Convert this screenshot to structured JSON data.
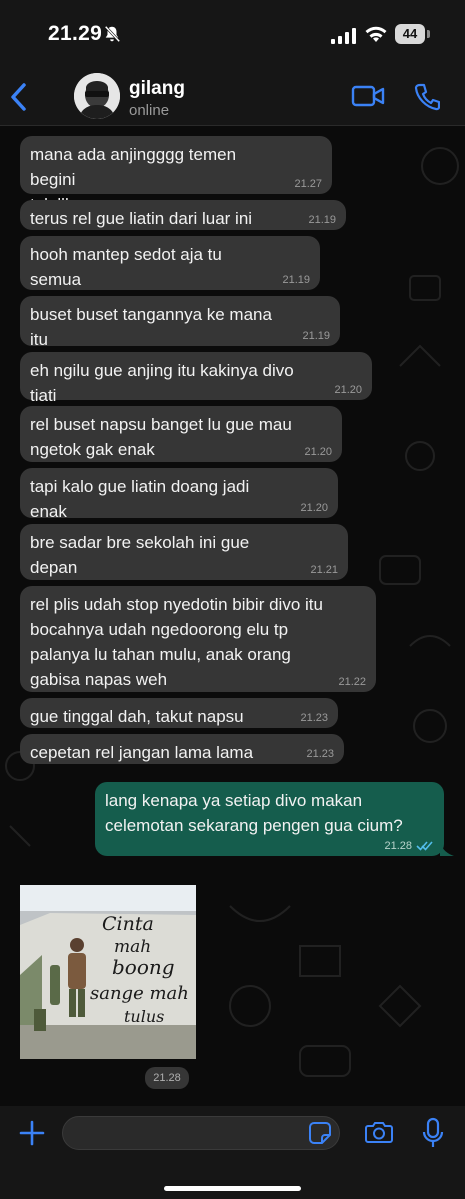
{
  "status_bar": {
    "time": "21.29",
    "battery": "44"
  },
  "header": {
    "name": "gilang",
    "status": "online"
  },
  "messages": [
    {
      "text": "mana ada anjingggg temen begini\ntololll",
      "time": "21.27"
    },
    {
      "text": "terus rel gue liatin dari luar ini",
      "time": "21.19"
    },
    {
      "text": "hooh mantep sedot aja tu semua\nbibirnya divo",
      "time": "21.19"
    },
    {
      "text": "buset buset tangannya ke mana itu",
      "time": "21.19"
    },
    {
      "text": "eh ngilu gue anjing itu kakinya divo tiati",
      "time": "21.20"
    },
    {
      "text": "rel buset napsu banget lu gue mau\nngetok gak enak",
      "time": "21.20"
    },
    {
      "text": "tapi kalo gue liatin doang jadi enak",
      "time": "21.20"
    },
    {
      "text": "bre sadar bre sekolah ini gue depan\nmobil lu",
      "time": "21.21"
    },
    {
      "text": "rel plis udah stop nyedotin bibir divo itu\nbocahnya udah ngedoorong elu tp\npalanya lu tahan mulu, anak orang\ngabisa napas weh",
      "time": "21.22"
    },
    {
      "text": "gue tinggal dah, takut napsu",
      "time": "21.23"
    },
    {
      "text": "cepetan rel jangan lama lama",
      "time": "21.23"
    }
  ],
  "outgoing": {
    "text": "lang kenapa ya setiap divo makan\ncelemotan sekarang pengen gua cium?",
    "time": "21.28"
  },
  "image_message": {
    "caption_lines": [
      "Cinta",
      "mah",
      "boong",
      "sange mah",
      "tulus"
    ],
    "time": "21.28"
  },
  "colors": {
    "incoming_bubble": "#363636",
    "outgoing_bubble": "#155d4d",
    "accent": "#3b82f6",
    "read_ticks": "#53bdeb"
  },
  "icons": [
    "bell-slash-icon",
    "signal-icon",
    "wifi-icon",
    "back-chevron-icon",
    "video-call-icon",
    "phone-icon",
    "plus-icon",
    "sticker-icon",
    "camera-icon",
    "mic-icon",
    "double-check-icon"
  ]
}
